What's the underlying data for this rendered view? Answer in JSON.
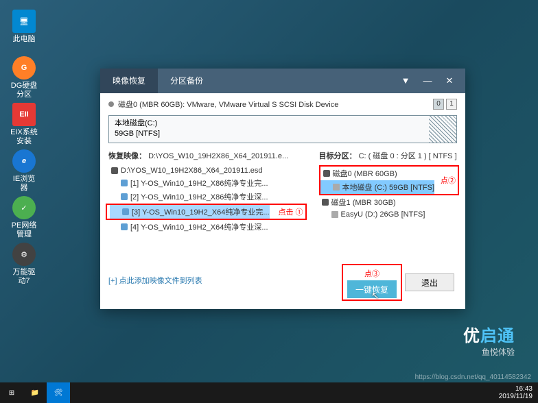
{
  "desktop": {
    "icons": [
      {
        "label": "此电脑",
        "color": "#0288d1"
      },
      {
        "label": "DG硬盘分区",
        "color": "#ff7f27"
      },
      {
        "label": "EIX系统安装",
        "color": "#e53935"
      },
      {
        "label": "IE浏览器",
        "color": "#1976d2"
      },
      {
        "label": "PE网络管理",
        "color": "#4caf50"
      },
      {
        "label": "万能驱动7",
        "color": "#424242"
      }
    ]
  },
  "dialog": {
    "tabs": {
      "restore": "映像恢复",
      "backup": "分区备份"
    },
    "titlebar": {
      "dropdown": "▼",
      "minimize": "—",
      "close": "✕"
    },
    "disk": {
      "name": "磁盘0 (MBR 60GB): VMware, VMware Virtual S SCSI Disk Device",
      "page0": "0",
      "page1": "1"
    },
    "partition": {
      "name": "本地磁盘(C:)",
      "size": "59GB [NTFS]"
    },
    "left": {
      "title": "恢复映像：",
      "path": "D:\\YOS_W10_19H2X86_X64_201911.e...",
      "items": [
        "D:\\YOS_W10_19H2X86_X64_201911.esd",
        "[1] Y-OS_Win10_19H2_X86纯净专业完...",
        "[2] Y-OS_Win10_19H2_X86纯净专业深...",
        "[3] Y-OS_Win10_19H2_X64纯净专业完...",
        "[4] Y-OS_Win10_19H2_X64纯净专业深..."
      ],
      "anno1": "点击 ①",
      "add": "[+] 点此添加映像文件到列表"
    },
    "right": {
      "title": "目标分区：",
      "path": "C: ( 磁盘 0 : 分区 1 ) [ NTFS ]",
      "items": [
        "磁盘0 (MBR 60GB)",
        "本地磁盘 (C:) 59GB [NTFS]",
        "磁盘1 (MBR 30GB)",
        "EasyU (D:) 26GB [NTFS]"
      ],
      "anno2": "点②"
    },
    "buttons": {
      "anno3": "点③",
      "restore": "一键恢复",
      "exit": "退出"
    }
  },
  "brand": {
    "text_pre": "优",
    "text_hl": "启通",
    "sub": "鱼悦体验"
  },
  "taskbar": {
    "time": "16:43",
    "date": "2019/11/19"
  },
  "watermark": "https://blog.csdn.net/qq_40114582342",
  "icons": {
    "pc": "🖥",
    "dg": "G",
    "eix": "EII",
    "ie": "e",
    "net": "✓",
    "drv": "⚙",
    "start": "⊞",
    "folder": "📁",
    "tool": "🛠"
  }
}
